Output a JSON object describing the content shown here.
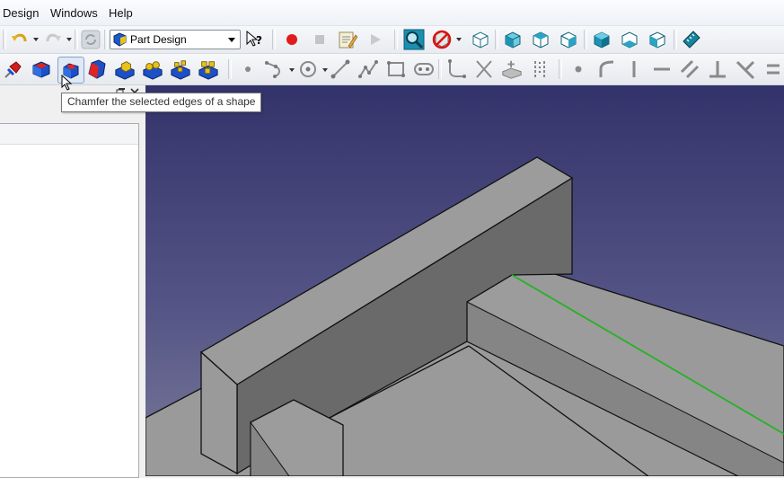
{
  "menubar": {
    "items": [
      {
        "label": "Design"
      },
      {
        "label": "Windows"
      },
      {
        "label": "Help"
      }
    ]
  },
  "toolbar1": {
    "undo_icon": "undo-icon",
    "redo_icon": "redo-icon",
    "refresh_icon": "refresh-icon",
    "workbench_selector": {
      "value": "Part Design",
      "icon": "part-design-icon"
    },
    "whats_this_icon": "whats-this-icon",
    "macro_icons": [
      "record-macro-icon",
      "stop-macro-icon",
      "edit-macro-icon",
      "play-macro-icon"
    ],
    "view_icons": [
      "fit-all-icon",
      "draw-style-icon",
      "axonometric-view-icon",
      "front-view-icon",
      "top-view-icon",
      "right-view-icon",
      "rear-view-icon",
      "bottom-view-icon",
      "left-view-icon",
      "measure-icon"
    ]
  },
  "toolbar2": {
    "feature_icons": [
      "sketch-pin-icon",
      "pad-icon",
      "chamfer-icon",
      "draft-icon",
      "pocket-icon",
      "groove-icon",
      "pattern-icon",
      "multi-transform-icon"
    ],
    "sketcher_icons": [
      "point-icon",
      "polyline-icon",
      "circle-icon",
      "line-icon",
      "bspline-icon",
      "rectangle-icon",
      "slot-icon",
      "fillet-icon",
      "trim-icon",
      "external-geometry-icon",
      "construction-mode-icon"
    ],
    "constraint_icons": [
      "coincident-icon",
      "tangent-icon",
      "vertical-icon",
      "horizontal-icon",
      "parallel-icon",
      "perpendicular-icon",
      "symmetric-icon",
      "equal-icon"
    ]
  },
  "tooltip": {
    "text": "Chamfer the selected edges of a shape"
  },
  "panel": {
    "float_icon": "float-icon",
    "close_icon": "close-icon"
  },
  "colors": {
    "viewport_top": "#33336b",
    "viewport_bottom": "#7a7a9a",
    "model_face_top": "#9a9a9a",
    "model_face_side": "#6b6b6b",
    "selected_edge": "#27b327"
  }
}
